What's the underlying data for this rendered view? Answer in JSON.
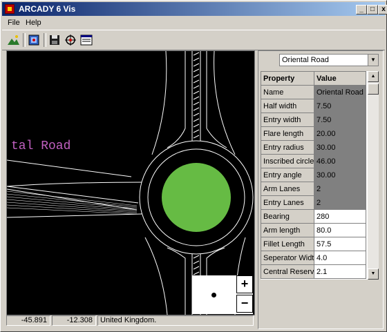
{
  "window": {
    "title": "ARCADY 6 Vis",
    "minimize": "_",
    "maximize": "□",
    "close": "x"
  },
  "menu": {
    "file": "File",
    "help": "Help"
  },
  "toolbar": [
    "terrain-icon",
    "image-icon",
    "save-icon",
    "target-icon",
    "window-icon"
  ],
  "canvas": {
    "road_label": "tal Road",
    "road_color": "#c060c0",
    "island_color": "#66bb44"
  },
  "zoom": {
    "plus": "+",
    "minus": "−"
  },
  "status": {
    "x": "-45.891",
    "y": "-12.308",
    "region": "United Kingdom."
  },
  "panel": {
    "selected_arm": "Oriental Road",
    "header_property": "Property",
    "header_value": "Value",
    "rows": [
      {
        "property": "Name",
        "value": "Oriental Road",
        "readonly": true
      },
      {
        "property": "Half width",
        "value": "7.50",
        "readonly": true
      },
      {
        "property": "Entry width",
        "value": "7.50",
        "readonly": true
      },
      {
        "property": "Flare length",
        "value": "20.00",
        "readonly": true
      },
      {
        "property": "Entry radius",
        "value": "30.00",
        "readonly": true
      },
      {
        "property": "Inscribed circle",
        "value": "46.00",
        "readonly": true
      },
      {
        "property": "Entry angle",
        "value": "30.00",
        "readonly": true
      },
      {
        "property": "Arm Lanes",
        "value": "2",
        "readonly": true
      },
      {
        "property": "Entry Lanes",
        "value": "2",
        "readonly": true
      },
      {
        "property": "Bearing",
        "value": "280",
        "readonly": false
      },
      {
        "property": "Arm length",
        "value": "80.0",
        "readonly": false
      },
      {
        "property": "Fillet Length",
        "value": "57.5",
        "readonly": false
      },
      {
        "property": "Seperator Widtl",
        "value": "4.0",
        "readonly": false
      },
      {
        "property": "Central Reserv",
        "value": "2.1",
        "readonly": false
      }
    ]
  }
}
